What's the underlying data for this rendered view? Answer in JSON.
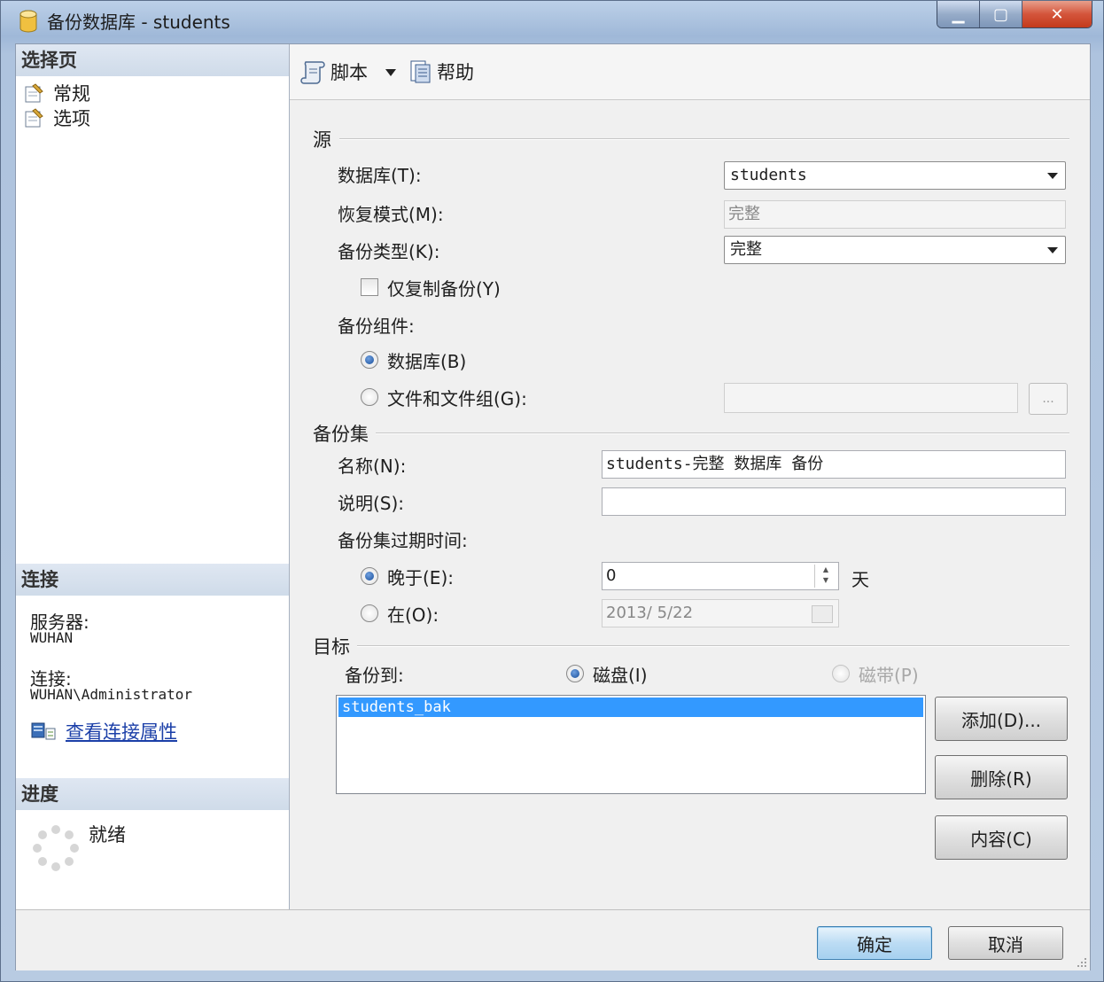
{
  "window": {
    "title": "备份数据库 - students"
  },
  "sidebar": {
    "select_page_header": "选择页",
    "pages": [
      {
        "label": "常规"
      },
      {
        "label": "选项"
      }
    ],
    "connection_header": "连接",
    "server_label": "服务器:",
    "server_value": "WUHAN",
    "connection_label": "连接:",
    "connection_value": "WUHAN\\Administrator",
    "view_properties_link": "查看连接属性",
    "progress_header": "进度",
    "progress_status": "就绪"
  },
  "toolbar": {
    "script_label": "脚本",
    "help_label": "帮助"
  },
  "source": {
    "group_label": "源",
    "database_label": "数据库(T):",
    "database_value": "students",
    "recovery_model_label": "恢复模式(M):",
    "recovery_model_value": "完整",
    "backup_type_label": "备份类型(K):",
    "backup_type_value": "完整",
    "copy_only_label": "仅复制备份(Y)",
    "component_label": "备份组件:",
    "component_database_label": "数据库(B)",
    "component_files_label": "文件和文件组(G):",
    "browse_label": "..."
  },
  "backup_set": {
    "group_label": "备份集",
    "name_label": "名称(N):",
    "name_value": "students-完整 数据库 备份",
    "description_label": "说明(S):",
    "description_value": "",
    "expire_label": "备份集过期时间:",
    "after_label": "晚于(E):",
    "after_value": "0",
    "days_label": "天",
    "on_label": "在(O):",
    "on_value": "2013/ 5/22"
  },
  "destination": {
    "group_label": "目标",
    "backup_to_label": "备份到:",
    "disk_label": "磁盘(I)",
    "tape_label": "磁带(P)",
    "items": [
      "students_bak"
    ],
    "add_button": "添加(D)...",
    "remove_button": "删除(R)",
    "contents_button": "内容(C)"
  },
  "footer": {
    "ok_button": "确定",
    "cancel_button": "取消"
  },
  "colors": {
    "selection": "#3399ff",
    "link": "#1b3fa8"
  }
}
